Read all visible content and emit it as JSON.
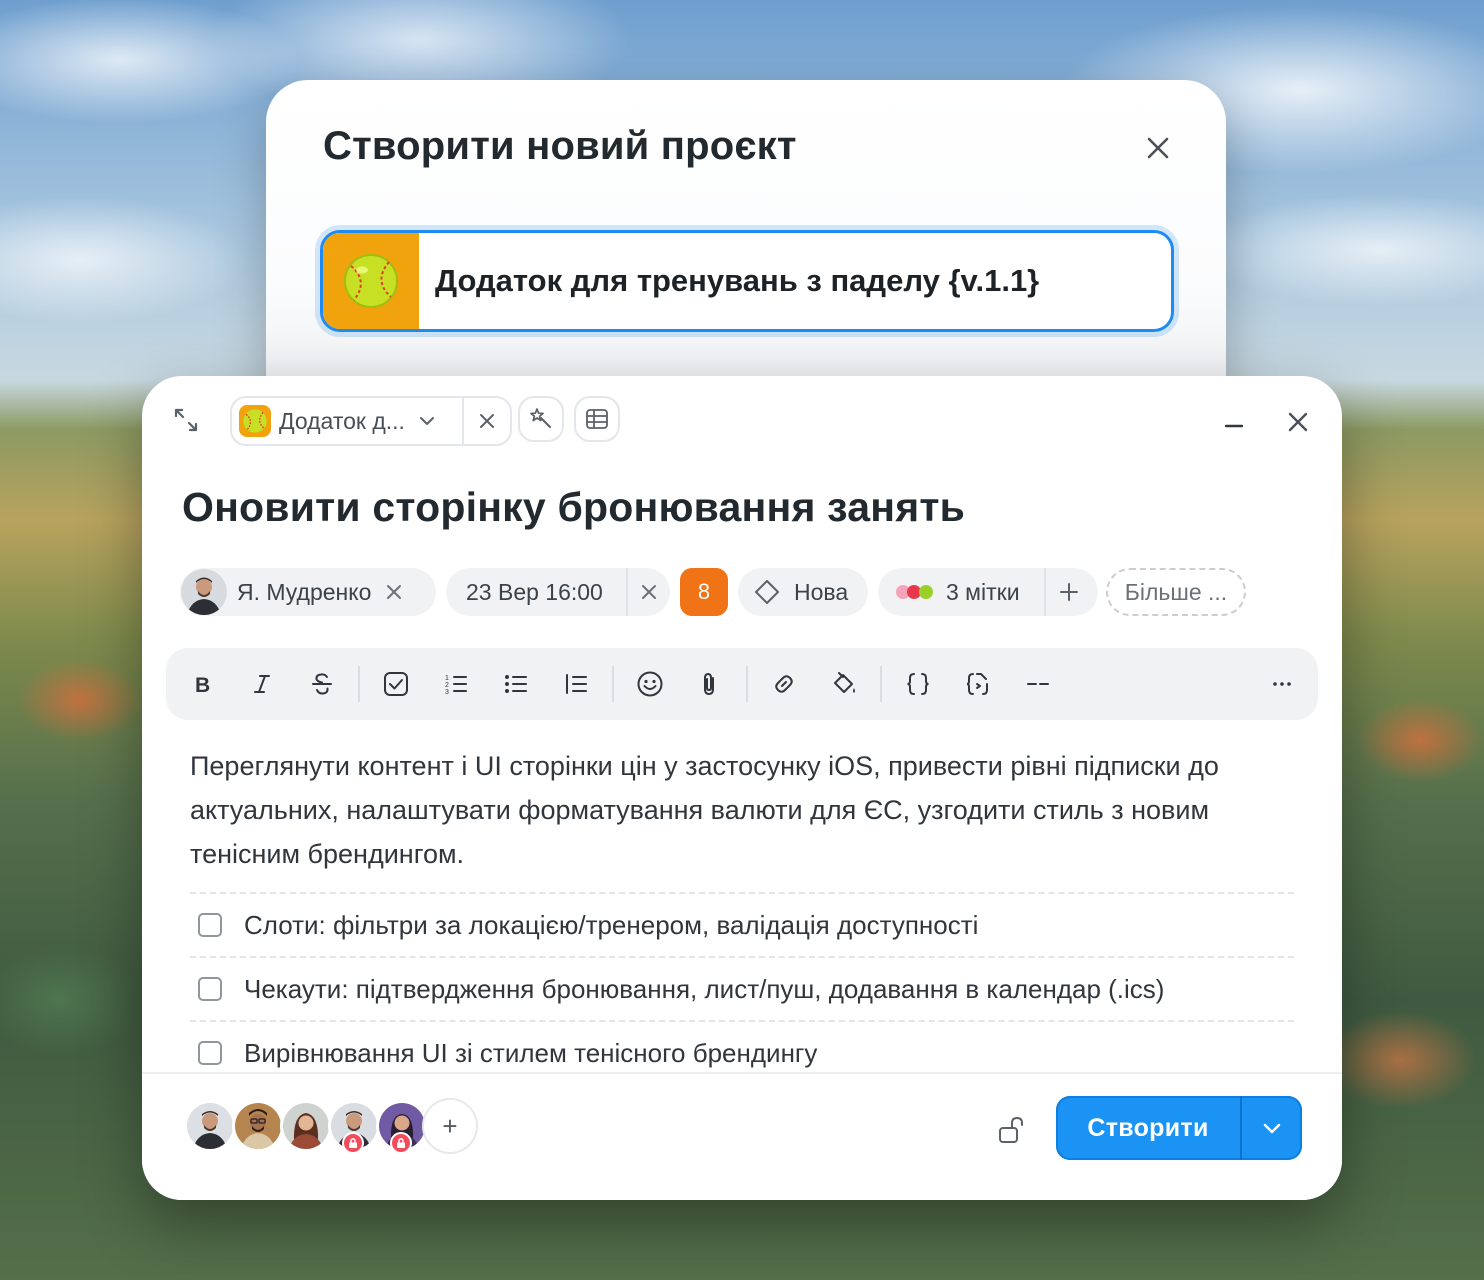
{
  "back_modal": {
    "title": "Створити новий проєкт",
    "project_name": "Додаток для тренувань з паделу {v.1.1}"
  },
  "topbar": {
    "project_chip_label": "Додаток д..."
  },
  "task": {
    "title": "Оновити сторінку бронювання занять",
    "assignee": "Я. Мудренко",
    "due": "23 Вер 16:00",
    "priority": "8",
    "status": "Нова",
    "labels": "3 мітки",
    "more": "Більше ...",
    "description": "Переглянути контент і UI сторінки цін у застосунку iOS, привести рівні підписки до актуальних, налаштувати форматування валюти для ЄС, узгодити стиль з новим тенісним брендингом.",
    "todos": [
      "Слоти: фільтри за локацією/тренером, валідація доступності",
      "Чекаути: підтвердження бронювання, лист/пуш, додавання в календар (.ics)",
      "Вирівнювання UI зі стилем тенісного брендингу"
    ]
  },
  "footer": {
    "add_member": "+",
    "create_label": "Створити"
  },
  "colors": {
    "accent": "#1a93f5",
    "priority": "#f07316",
    "project": "#f1a30e"
  }
}
